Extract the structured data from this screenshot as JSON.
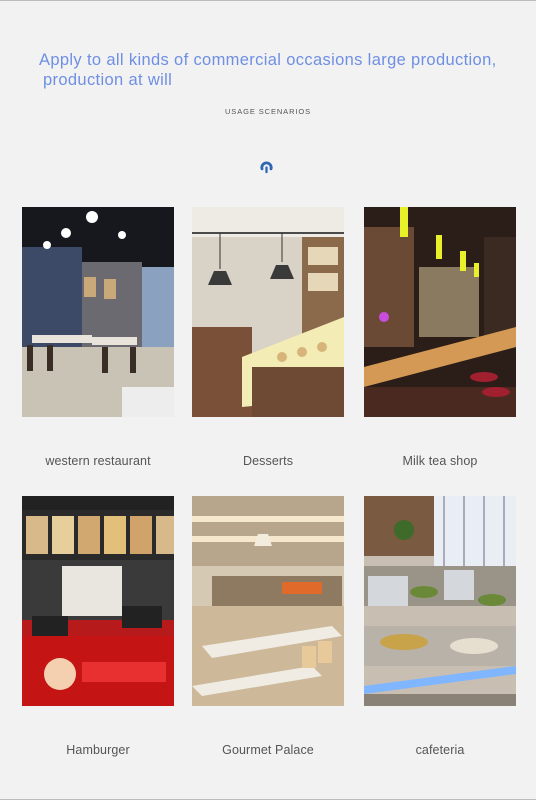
{
  "header": {
    "headline_line1": "Apply to all kinds of commercial occasions large production,",
    "headline_line2": "production at will",
    "subtitle": "USAGE SCENARIOS",
    "divider_icon": "hook-icon"
  },
  "scenarios": [
    {
      "label": "western restaurant"
    },
    {
      "label": "Desserts"
    },
    {
      "label": "Milk tea shop"
    },
    {
      "label": "Hamburger"
    },
    {
      "label": "Gourmet Palace"
    },
    {
      "label": "cafeteria"
    }
  ],
  "colors": {
    "headline": "#6f8fe3",
    "icon": "#2f66b3",
    "background": "#f2f2f2"
  }
}
